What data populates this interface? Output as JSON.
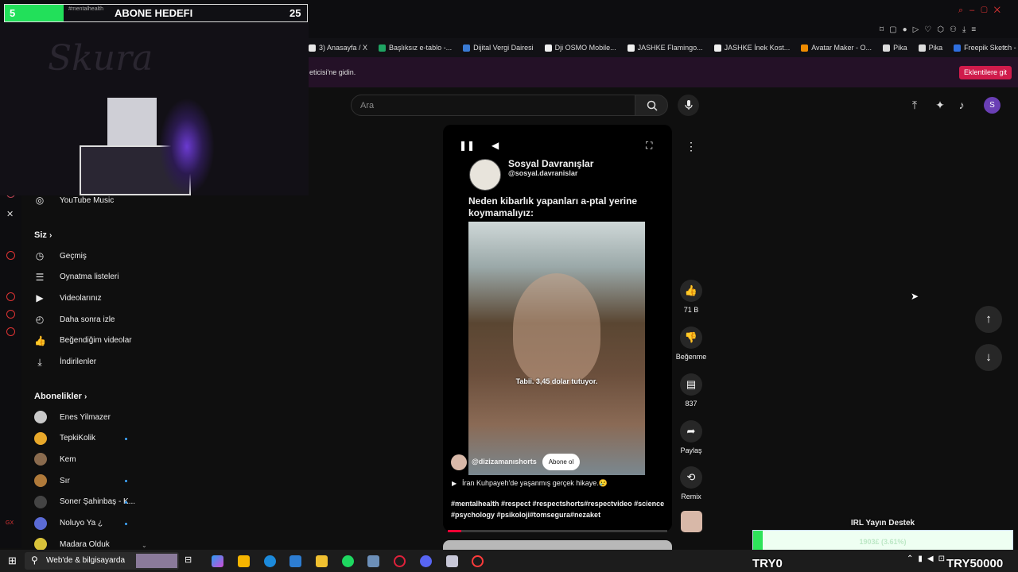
{
  "stream_overlay": {
    "goal_count": "5",
    "goal_title": "ABONE HEDEFI",
    "goal_target": "25",
    "tab_fragment": "#mentalhealth",
    "support_title": "IRL Yayın Destek",
    "support_progress": "1903£ (3.61%)",
    "support_fraction": 0.0361,
    "try_left": "TRY0",
    "try_right": "TRY50000"
  },
  "browser": {
    "bookmarks": [
      {
        "label": "3) Anasayfa / X",
        "color": "#e7e7e7"
      },
      {
        "label": "Başlıksız e-tablo -...",
        "color": "#1fa463"
      },
      {
        "label": "Dijital Vergi Dairesi",
        "color": "#3a7bd5"
      },
      {
        "label": "Dji OSMO Mobile...",
        "color": "#f0f0f0"
      },
      {
        "label": "JASHKE Flamingo...",
        "color": "#f0f0f0"
      },
      {
        "label": "JASHKE İnek Kost...",
        "color": "#f0f0f0"
      },
      {
        "label": "Avatar Maker - O...",
        "color": "#f08c00"
      },
      {
        "label": "Pika",
        "color": "#dddddd"
      },
      {
        "label": "Pika",
        "color": "#dddddd"
      },
      {
        "label": "Freepik Sketch - F...",
        "color": "#2f6fe0"
      }
    ],
    "infobar_text": "eticisi'ne gidin.",
    "infobar_button": "Eklentilere git"
  },
  "header": {
    "search_placeholder": "Ara",
    "avatar_letter": "S"
  },
  "sidebar": {
    "music": "YouTube Music",
    "you_title": "Siz",
    "you_items": [
      {
        "label": "Geçmiş",
        "icon": "history-icon"
      },
      {
        "label": "Oynatma listeleri",
        "icon": "playlists-icon"
      },
      {
        "label": "Videolarınız",
        "icon": "your-videos-icon"
      },
      {
        "label": "Daha sonra izle",
        "icon": "watch-later-icon"
      },
      {
        "label": "Beğendiğim videolar",
        "icon": "liked-icon"
      },
      {
        "label": "İndirilenler",
        "icon": "download-icon"
      }
    ],
    "subs_title": "Abonelikler",
    "subs": [
      {
        "label": "Enes Yilmazer",
        "color": "#c9c9c9",
        "dot": false
      },
      {
        "label": "TepkiKolik",
        "color": "#e8a82a",
        "dot": true
      },
      {
        "label": "Kem",
        "color": "#8a6b4e",
        "dot": false
      },
      {
        "label": "Sır",
        "color": "#b07a3a",
        "dot": true
      },
      {
        "label": "Soner Şahinbaş - K...",
        "color": "#444444",
        "dot": true
      },
      {
        "label": "Noluyo Ya ¿",
        "color": "#5b6bd6",
        "dot": true
      },
      {
        "label": "Madara Olduk",
        "color": "#d8c23a",
        "dot": false
      }
    ]
  },
  "short": {
    "channel_name": "Sosyal Davranışlar",
    "channel_handle": "@sosyal.davranislar",
    "headline": "Neden kibarlık yapanları a-ptal yerine koymamalıyız:",
    "subtitle": "Tabii. 3,45 dolar tutuyor.",
    "uploader": "@dizizamanıshorts",
    "subscribe": "Abone ol",
    "description": "İran Kuhpayeh'de yaşanmış gerçek hikaye.😢",
    "hashtags": "#mentalhealth #respect #respectshorts#respectvideo #science #psychology #psikoloji#tomsegura#nezaket",
    "progress": 0.06
  },
  "actions": {
    "likes": "71 B",
    "dislike": "Beğenme",
    "comments": "837",
    "share": "Paylaş",
    "remix": "Remix"
  },
  "taskbar": {
    "search": "Web'de & bilgisayarda"
  }
}
